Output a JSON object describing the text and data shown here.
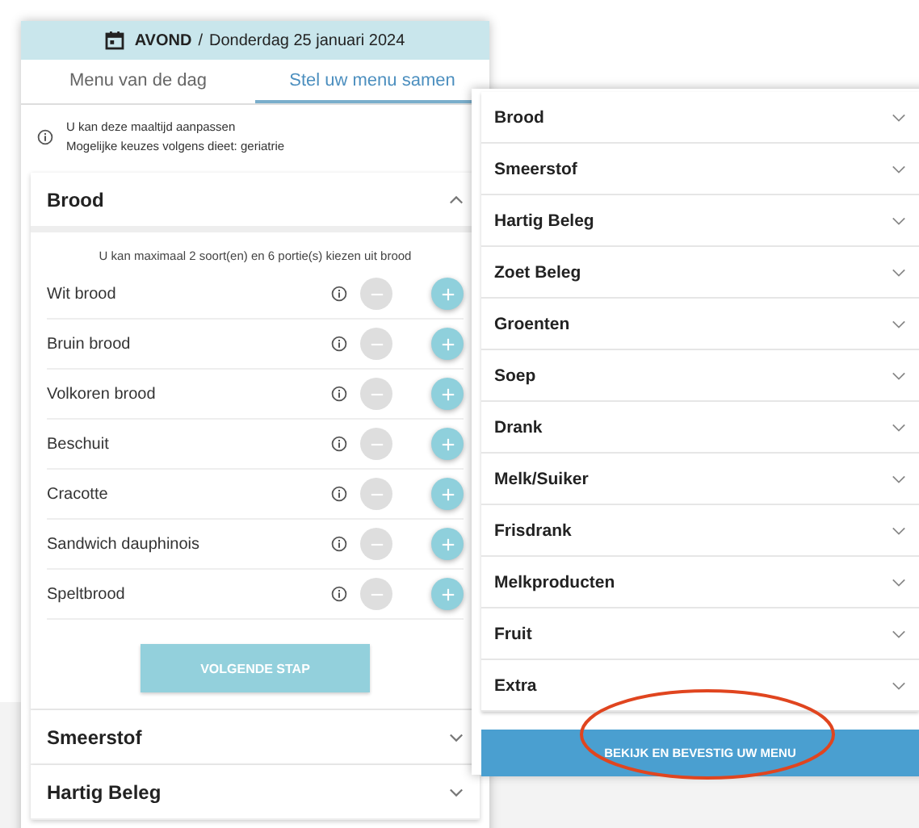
{
  "header": {
    "meal": "AVOND",
    "separator": "/",
    "date": "Donderdag 25 januari 2024"
  },
  "tabs": [
    {
      "label": "Menu van de dag",
      "selected": false
    },
    {
      "label": "Stel uw menu samen",
      "selected": true
    }
  ],
  "info": {
    "lines": [
      "U kan deze maaltijd aanpassen",
      "Mogelijke keuzes volgens dieet: geriatrie"
    ]
  },
  "sections": [
    {
      "title": "Brood",
      "expanded": true,
      "hint": "U kan maximaal 2 soort(en) en 6 portie(s) kiezen uit brood",
      "items": [
        {
          "name": "Wit brood",
          "decrease_disabled": true
        },
        {
          "name": "Bruin brood",
          "decrease_disabled": true
        },
        {
          "name": "Volkoren brood",
          "decrease_disabled": true
        },
        {
          "name": "Beschuit",
          "decrease_disabled": true
        },
        {
          "name": "Cracotte",
          "decrease_disabled": true
        },
        {
          "name": "Sandwich dauphinois",
          "decrease_disabled": true
        },
        {
          "name": "Speltbrood",
          "decrease_disabled": true
        }
      ],
      "next_button": {
        "label": "VOLGENDE STAP",
        "disabled": true
      }
    },
    {
      "title": "Smeerstof",
      "expanded": false
    },
    {
      "title": "Hartig Beleg",
      "expanded": false
    }
  ],
  "overview": {
    "categories": [
      {
        "title": "Brood",
        "expanded": false
      },
      {
        "title": "Smeerstof",
        "expanded": false
      },
      {
        "title": "Hartig Beleg",
        "expanded": false
      },
      {
        "title": "Zoet Beleg",
        "expanded": false
      },
      {
        "title": "Groenten",
        "expanded": false
      },
      {
        "title": "Soep",
        "expanded": false
      },
      {
        "title": "Drank",
        "expanded": false
      },
      {
        "title": "Melk/Suiker",
        "expanded": false
      },
      {
        "title": "Frisdrank",
        "expanded": false
      },
      {
        "title": "Melkproducten",
        "expanded": false
      },
      {
        "title": "Fruit",
        "expanded": false
      },
      {
        "title": "Extra",
        "expanded": false
      }
    ],
    "confirm_button": "BEKIJK EN BEVESTIG UW MENU"
  }
}
